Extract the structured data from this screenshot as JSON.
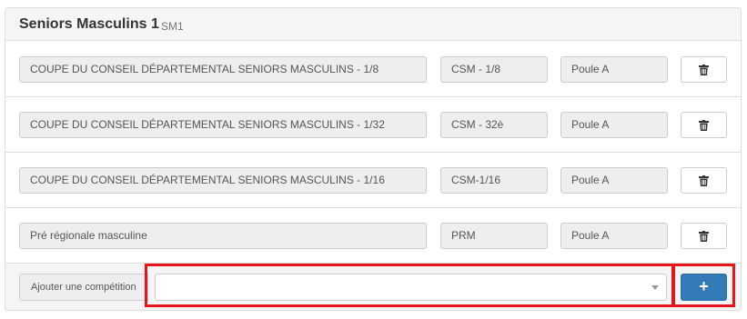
{
  "team": {
    "name": "Seniors Masculins 1",
    "code": "SM1"
  },
  "competitions": [
    {
      "name": "COUPE DU CONSEIL DÉPARTEMENTAL SENIORS MASCULINS - 1/8",
      "code": "CSM - 1/8",
      "pool": "Poule A"
    },
    {
      "name": "COUPE DU CONSEIL DÉPARTEMENTAL SENIORS MASCULINS - 1/32",
      "code": "CSM - 32è",
      "pool": "Poule A"
    },
    {
      "name": "COUPE DU CONSEIL DÉPARTEMENTAL SENIORS MASCULINS - 1/16",
      "code": "CSM-1/16",
      "pool": "Poule A"
    },
    {
      "name": "Pré régionale masculine",
      "code": "PRM",
      "pool": "Poule A"
    }
  ],
  "add_competition": {
    "label": "Ajouter une compétition",
    "selected": "",
    "button_label": "+"
  },
  "icons": {
    "delete": "trash-icon",
    "dropdown": "caret-down-icon"
  },
  "colors": {
    "primary": "#337ab7",
    "highlight": "#e8141b",
    "heading_bg": "#f5f5f5"
  }
}
